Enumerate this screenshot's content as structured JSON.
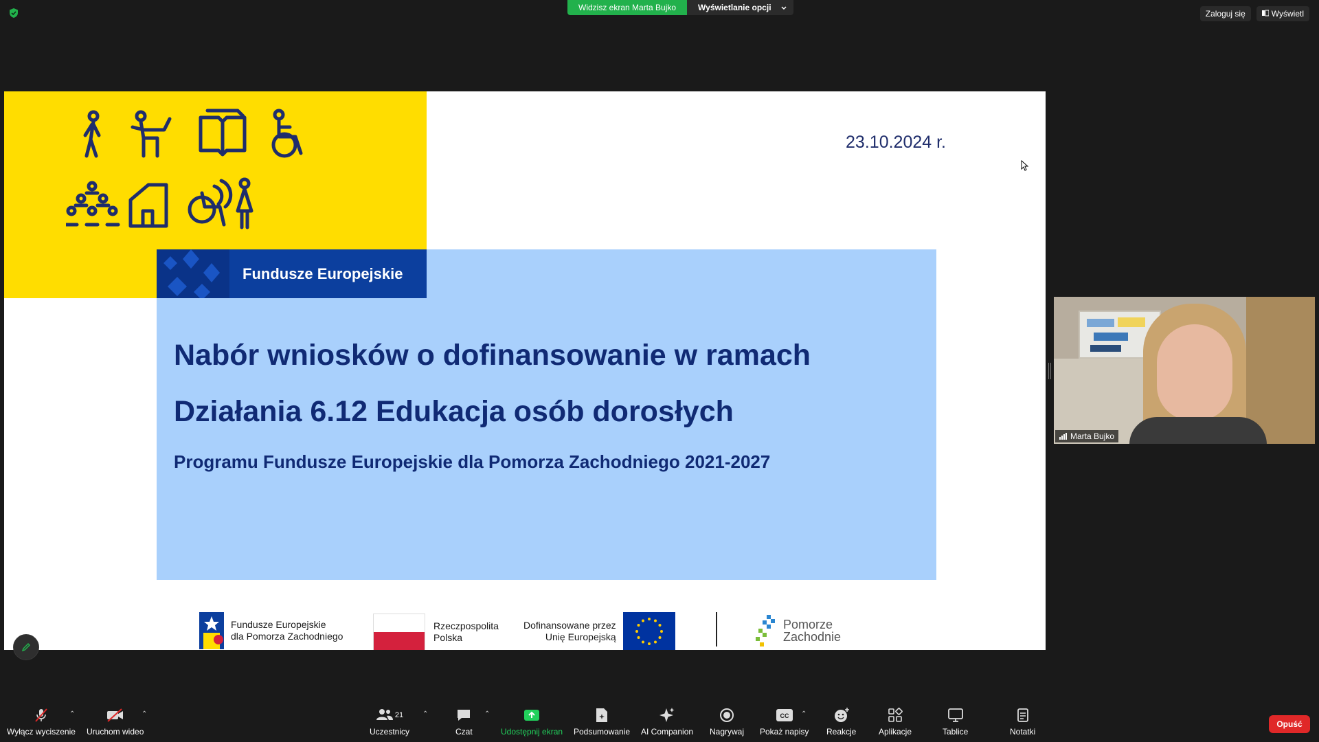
{
  "topbar": {
    "sharing_label": "Widzisz ekran Marta Bujko",
    "view_options_label": "Wyświetlanie opcji",
    "login_label": "Zaloguj się",
    "view_label": "Wyświetl"
  },
  "slide": {
    "date": "23.10.2024 r.",
    "band_label": "Fundusze Europejskie",
    "title_line1": "Nabór wniosków o dofinansowanie w ramach",
    "title_line2": "Działania 6.12  Edukacja osób dorosłych",
    "subtitle": "Programu Fundusze Europejskie dla Pomorza Zachodniego 2021-2027",
    "logos": {
      "fe_line1": "Fundusze Europejskie",
      "fe_line2": "dla Pomorza Zachodniego",
      "pl_line1": "Rzeczpospolita",
      "pl_line2": "Polska",
      "eu_line1": "Dofinansowane przez",
      "eu_line2": "Unię Europejską",
      "pz_line1": "Pomorze",
      "pz_line2": "Zachodnie"
    },
    "colors": {
      "yellow": "#ffdd00",
      "navy": "#102a74",
      "light_blue": "#a9d0fc",
      "band_blue": "#0c3f9e"
    }
  },
  "video": {
    "participant_name": "Marta Bujko"
  },
  "toolbar": {
    "mute": "Wyłącz wyciszenie",
    "video": "Uruchom wideo",
    "participants": "Uczestnicy",
    "participants_count": "21",
    "chat": "Czat",
    "share": "Udostępnij ekran",
    "summary": "Podsumowanie",
    "ai": "AI Companion",
    "record": "Nagrywaj",
    "captions": "Pokaż napisy",
    "reactions": "Reakcje",
    "apps": "Aplikacje",
    "whiteboards": "Tablice",
    "notes": "Notatki",
    "leave": "Opuść"
  }
}
